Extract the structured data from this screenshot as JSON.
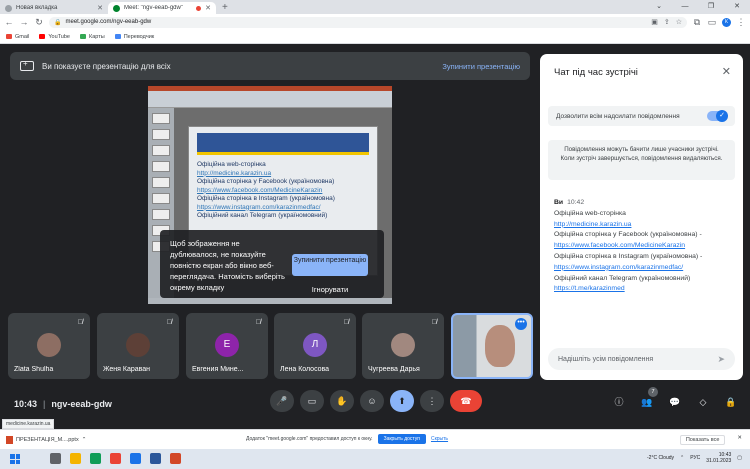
{
  "browser": {
    "tabs": [
      {
        "title": "Новая вкладка",
        "active": false
      },
      {
        "title": "Meet: \"ngv-eeab-gdw\"",
        "active": true
      }
    ],
    "url": "meet.google.com/ngv-eeab-gdw",
    "bookmarks": [
      "Gmail",
      "YouTube",
      "Карты",
      "Переводчик"
    ]
  },
  "meet": {
    "present_banner": {
      "text": "Ви показуєте презентацію для всіх",
      "stop_label": "Зупинити презентацію"
    },
    "presentation": {
      "lines": [
        "Офіційна web-сторінка",
        "http://medicine.karazin.ua",
        "Офіційна сторінка у Facebook (україномовна)",
        "https://www.facebook.com/MedicineKarazin",
        "Офіційна сторінка в Instagram (україномовна)",
        "https://www.instagram.com/karazinmedfac/",
        "Офіційний канал Telegram (україномовний)"
      ]
    },
    "dialog": {
      "message": "Щоб зображення не дублювалося, не показуйте повністю екран або вікно веб-переглядача. Натомість виберіть окрему вкладку",
      "stop_label": "Зупинити презентацію",
      "ignore_label": "Ігнорувати"
    },
    "participants": [
      {
        "name": "Zlata Shulha",
        "initial": "",
        "color": "#8d6e63"
      },
      {
        "name": "Женя Караван",
        "initial": "",
        "color": "#5d4037"
      },
      {
        "name": "Евгения Мине...",
        "initial": "Е",
        "color": "#8e24aa"
      },
      {
        "name": "Лена Колосова",
        "initial": "Л",
        "color": "#7e57c2"
      },
      {
        "name": "Чугреева Дарья",
        "initial": "",
        "color": "#a1887f"
      }
    ],
    "time": "10:43",
    "meeting_code": "ngv-eeab-gdw",
    "participant_count": "7"
  },
  "chat": {
    "title": "Чат під час зустрічі",
    "allow_label": "Дозволити всім надсилати повідомлення",
    "notice": "Повідомлення можуть бачити лише учасники зустрічі. Коли зустріч завершується, повідомлення видаляються.",
    "message": {
      "sender": "Ви",
      "time": "10:42",
      "lines": [
        {
          "text": "Офіційна web-сторінка",
          "link": false
        },
        {
          "text": "http://medicine.karazin.ua",
          "link": true
        },
        {
          "text": "Офіційна сторінка у Facebook (україномовна)  -",
          "link": false
        },
        {
          "text": "https://www.facebook.com/MedicineKarazin",
          "link": true
        },
        {
          "text": "Офіційна сторінка в Instagram (україномовна)  -",
          "link": false
        },
        {
          "text": "https://www.instagram.com/karazinmedfac/",
          "link": true
        },
        {
          "text": "Офіційний канал Telegram (україномовний)",
          "link": false
        },
        {
          "text": "https://t.me/karazinmed",
          "link": true
        }
      ]
    },
    "input_placeholder": "Надішліть усім повідомлення"
  },
  "status_url": "medicine.karazin.ua",
  "downloads": {
    "file": "ПРЕЗЕНТАЦІЯ_М....pptx",
    "share_text": "Додаток \"meet.google.com\" предоставил доступ к окну.",
    "share_btn": "Закрыть доступ",
    "hide_btn": "Скрыть",
    "show_all": "Показать все"
  },
  "taskbar": {
    "weather": "-2°C  Cloudy",
    "lang": "РУС",
    "time": "10:43",
    "date": "31.01.2023"
  }
}
